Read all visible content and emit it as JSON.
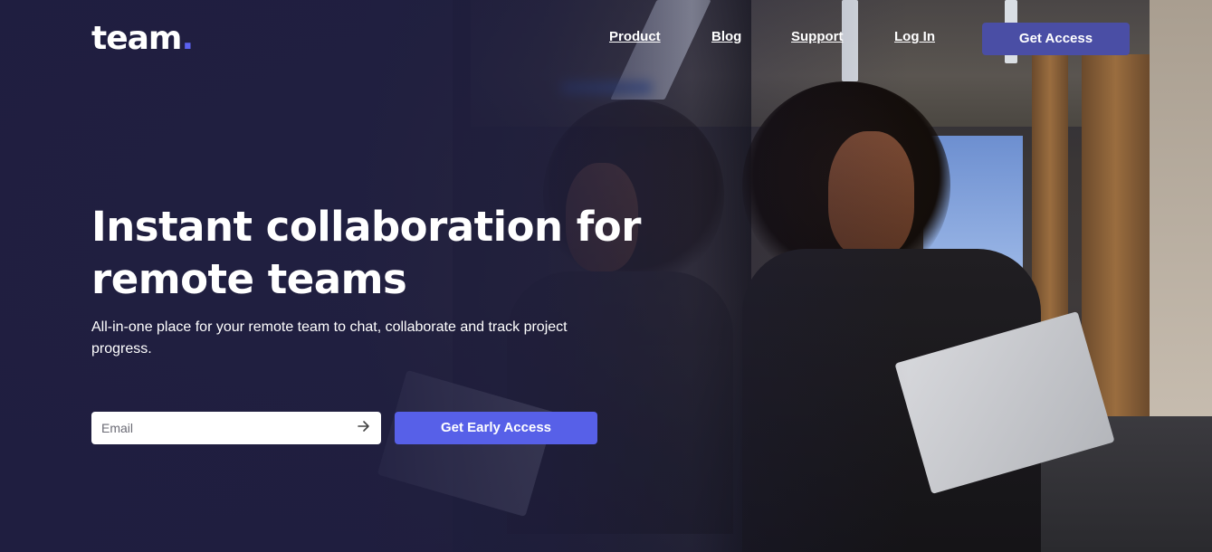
{
  "header": {
    "logo_text": "team",
    "logo_dot": ".",
    "nav": [
      {
        "label": "Product"
      },
      {
        "label": "Blog"
      },
      {
        "label": "Support"
      },
      {
        "label": "Log In"
      }
    ],
    "cta_label": "Get Access"
  },
  "hero": {
    "title": "Instant collaboration for remote teams",
    "subtitle": "All-in-one place for your remote team to chat, collaborate and track project progress.",
    "email_placeholder": "Email",
    "submit_icon": "arrow-right-icon",
    "cta_label": "Get Early Access"
  },
  "colors": {
    "overlay": "#1f1e40",
    "accent": "#5760e8",
    "header_button": "#4a4ea5",
    "text": "#ffffff"
  }
}
